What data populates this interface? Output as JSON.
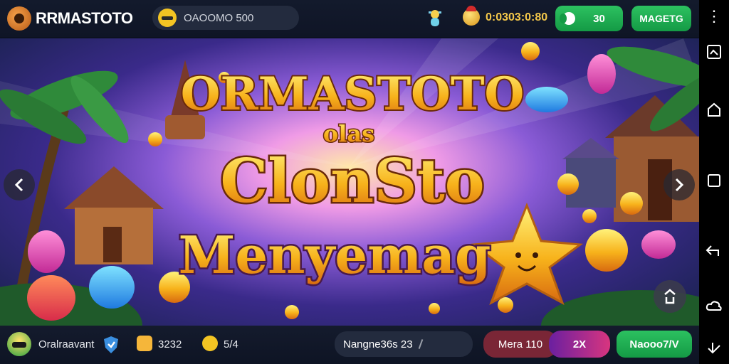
{
  "header": {
    "logo_text": "RRMASTOTO",
    "search_text": "OAOOMO 500",
    "balance": "0:0303:0:80",
    "deposit_label": "30",
    "register_label": "MAGETG"
  },
  "banner": {
    "title_line1": "ORMASTOTO",
    "title_line2": "olas",
    "title_line3": "ClonSto",
    "title_line4": "Menyemag"
  },
  "footer": {
    "username": "Oralraavant",
    "stat1": "3232",
    "stat2": "5/4",
    "nav_text": "Nangne36s 23",
    "mera_label": "Mera 110",
    "multiplier": "2X",
    "cta_label": "Naooo7/V"
  },
  "colors": {
    "accent_green": "#1fa94f",
    "gold": "#f5c84a",
    "brand_red": "#7a2a3a",
    "pink": "#c93a8c"
  },
  "icons": [
    "logo-icon",
    "smile-icon",
    "bug-icon",
    "coin-icon",
    "toggle-icon",
    "chevron-left-icon",
    "chevron-right-icon",
    "share-icon",
    "helmet-icon",
    "shield-icon",
    "coin-icon",
    "smile-icon",
    "close-icon",
    "screenshot-icon",
    "home-icon",
    "square-icon",
    "back-icon",
    "cloud-icon",
    "hand-icon"
  ]
}
